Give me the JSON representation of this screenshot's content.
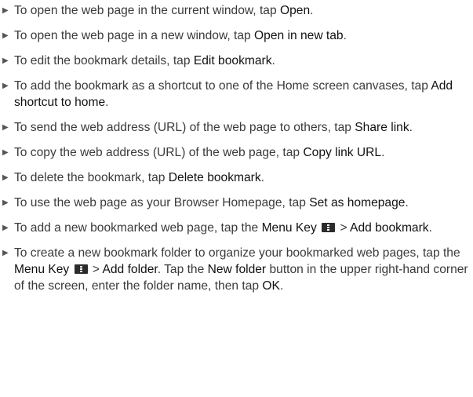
{
  "icons": {
    "bullet": "triangle-right-bullet",
    "menu_key": "menu-key-icon"
  },
  "items": [
    {
      "t1": "To open the web page in the current window, tap ",
      "b1": "Open",
      "t2": "."
    },
    {
      "t1": "To open the web page in a new window, tap ",
      "b1": "Open in new tab",
      "t2": "."
    },
    {
      "t1": "To edit the bookmark details, tap ",
      "b1": "Edit bookmark",
      "t2": "."
    },
    {
      "t1": "To add the bookmark as a shortcut to one of the Home screen canvases, tap ",
      "b1": "Add shortcut to home",
      "t2": "."
    },
    {
      "t1": "To send the web address (URL) of the web page to others, tap ",
      "b1": "Share link",
      "t2": "."
    },
    {
      "t1": "To copy the web address (URL) of the web page, tap ",
      "b1": "Copy link URL",
      "t2": "."
    },
    {
      "t1": "To delete the bookmark, tap ",
      "b1": "Delete bookmark",
      "t2": "."
    },
    {
      "t1": "To use the web page as your Browser Homepage, tap ",
      "b1": "Set as homepage",
      "t2": "."
    },
    {
      "t1": "To add a new bookmarked web page, tap the ",
      "b1": "Menu Key",
      "t2": " > ",
      "b2": "Add bookmark",
      "t3": "."
    },
    {
      "t1": "To create a new bookmark folder to organize your bookmarked web pages, tap the ",
      "b1": "Menu Key",
      "t2": " > ",
      "b2": "Add folder",
      "t3": ". Tap the ",
      "b3": "New folder",
      "t4": " button in the upper right-hand corner of the screen, enter the folder name, then tap ",
      "b4": "OK",
      "t5": "."
    }
  ]
}
